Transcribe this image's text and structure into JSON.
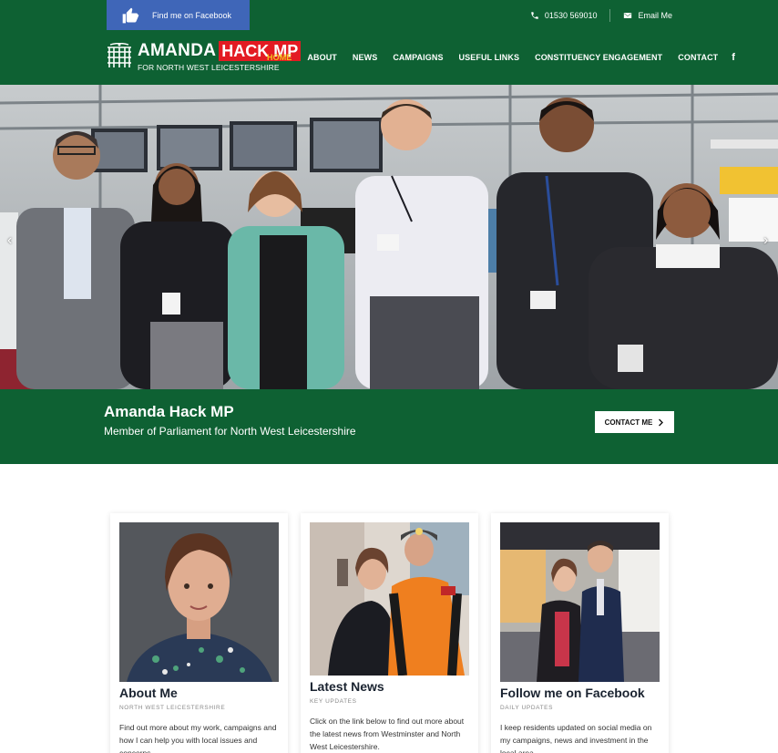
{
  "topbar": {
    "facebook_label": "Find me on Facebook",
    "phone": "01530 569010",
    "email_label": "Email Me",
    "bg_color": "#0e6133",
    "facebook_color": "#3f66b8",
    "icons": [
      "thumbs-up-icon",
      "phone-icon",
      "envelope-icon"
    ]
  },
  "logo": {
    "name_first": "AMANDA",
    "name_highlight": "HACK MP",
    "subtitle": "FOR NORTH WEST LEICESTERSHIRE",
    "highlight_color": "#e31b23"
  },
  "nav": {
    "items": [
      {
        "label": "HOME",
        "active": true
      },
      {
        "label": "ABOUT",
        "active": false
      },
      {
        "label": "NEWS",
        "active": false
      },
      {
        "label": "CAMPAIGNS",
        "active": false
      },
      {
        "label": "USEFUL LINKS",
        "active": false
      },
      {
        "label": "CONSTITUENCY ENGAGEMENT",
        "active": false
      },
      {
        "label": "CONTACT",
        "active": false
      }
    ],
    "facebook_icon": "f",
    "active_color": "#f2c21d"
  },
  "hero": {
    "prev_arrow": "‹",
    "next_arrow": "›",
    "title": "Amanda Hack MP",
    "subtitle": "Member of Parliament for North West Leicestershire",
    "cta_label": "CONTACT ME",
    "cta_icon": "chevron-right-icon"
  },
  "cards": [
    {
      "title": "About Me",
      "kicker": "NORTH WEST LEICESTERSHIRE",
      "body": "Find out more about my work, campaigns and how I can help you with local issues and concerns."
    },
    {
      "title": "Latest News",
      "kicker": "KEY UPDATES",
      "body": "Click on the link below to find out more about the latest news from Westminster and North West Leicestershire."
    },
    {
      "title": "Follow me on Facebook",
      "kicker": "DAILY UPDATES",
      "body": "I keep residents updated on social media on my campaigns, news and investment in the local area."
    }
  ]
}
